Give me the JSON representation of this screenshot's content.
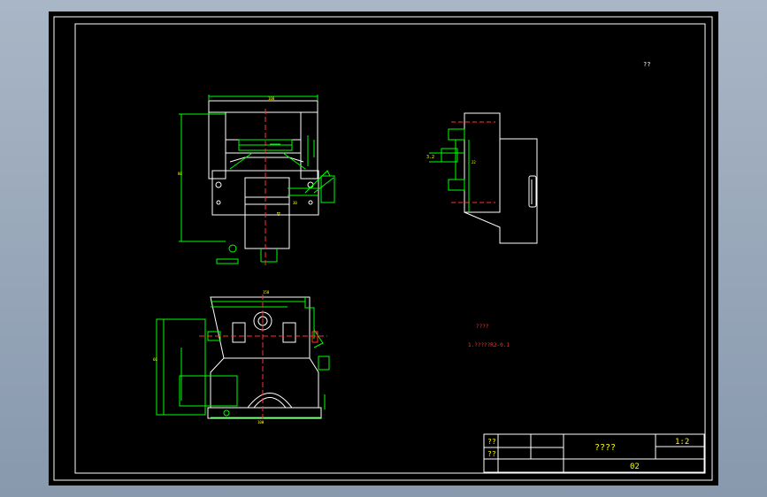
{
  "title_block": {
    "cell_r1c1": "??",
    "cell_r2c1": "??",
    "name": "????",
    "scale": "1:2",
    "number": "02"
  },
  "notes": {
    "line1": "????",
    "line2": "1.?????R2-0.1"
  },
  "corner_note": "??"
}
